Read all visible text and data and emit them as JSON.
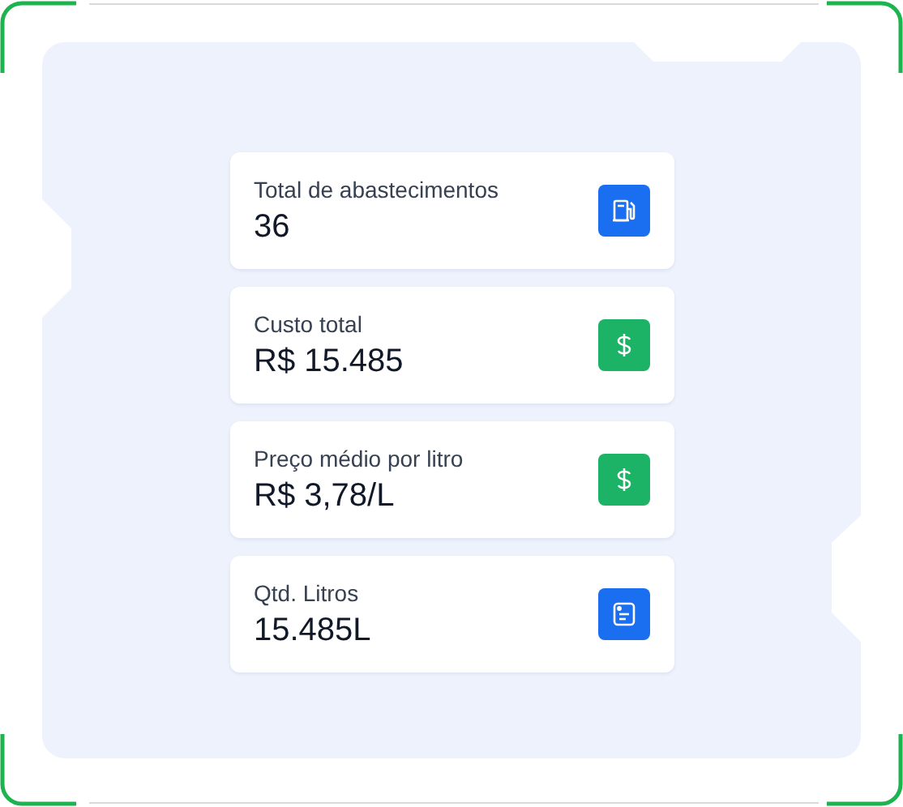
{
  "stats": [
    {
      "label": "Total de abastecimentos",
      "value": "36",
      "kind": "fuel",
      "color": "#1a6ef0"
    },
    {
      "label": "Custo total",
      "value": "R$ 15.485",
      "kind": "dollar",
      "color": "#1db366"
    },
    {
      "label": "Preço médio por litro",
      "value": "R$ 3,78/L",
      "kind": "dollar",
      "color": "#1db366"
    },
    {
      "label": "Qtd. Litros",
      "value": "15.485L",
      "kind": "receipt",
      "color": "#1a6ef0"
    }
  ]
}
